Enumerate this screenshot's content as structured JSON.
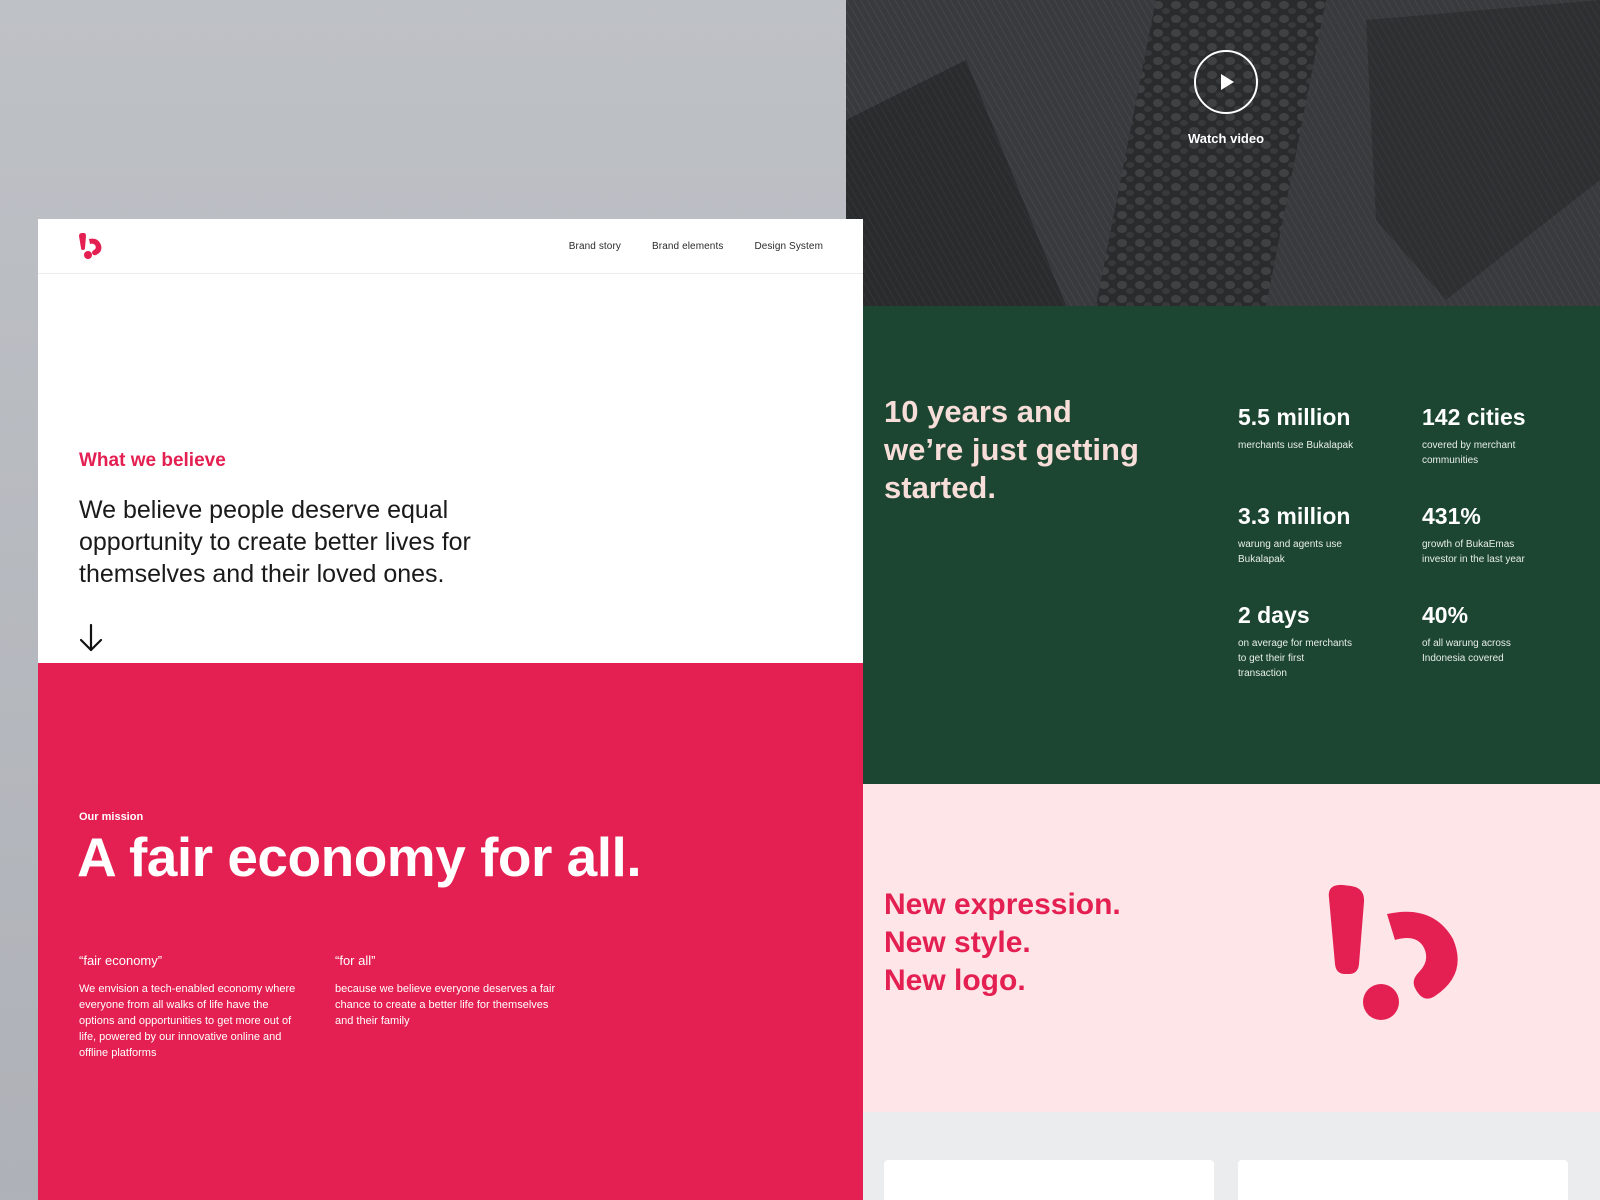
{
  "header": {
    "nav": [
      "Brand story",
      "Brand elements",
      "Design System"
    ]
  },
  "believe": {
    "eyebrow": "What we believe",
    "text": "We believe people deserve equal opportunity to create better lives for themselves and their loved ones."
  },
  "mission": {
    "eyebrow": "Our mission",
    "title": "A fair economy for all.",
    "pillars": [
      {
        "title": "“fair economy”",
        "text": "We envision a tech-enabled  economy where everyone from all walks of life have the options and opportunities to get more out of life, powered by our innovative online and offline platforms"
      },
      {
        "title": "“for all”",
        "text": "because we believe everyone deserves a fair chance to create a better life for themselves and their family"
      }
    ]
  },
  "video": {
    "label": "Watch video"
  },
  "stats": {
    "title": "10 years and we’re just getting started.",
    "items": [
      {
        "value": "5.5 million",
        "desc": "merchants use Bukalapak"
      },
      {
        "value": "142 cities",
        "desc": "covered by merchant communities"
      },
      {
        "value": "3.3 million",
        "desc": "warung and agents use Bukalapak"
      },
      {
        "value": "431%",
        "desc": "growth of BukaEmas investor in the last year"
      },
      {
        "value": "2 days",
        "desc": "on average for merchants to get their first transaction"
      },
      {
        "value": "40%",
        "desc": "of all warung across Indonesia covered"
      }
    ]
  },
  "newlogo": {
    "lines": [
      "New expression.",
      "New style.",
      "New logo."
    ]
  },
  "colors": {
    "brand_red": "#e41f51",
    "dark_green": "#1c4532",
    "pale_pink": "#fde5e8",
    "stats_heading": "#f7ded8"
  }
}
